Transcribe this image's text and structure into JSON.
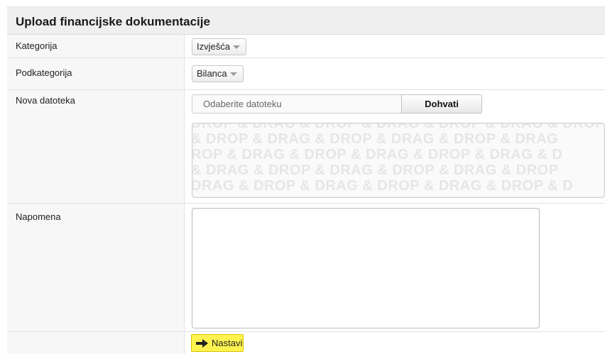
{
  "form": {
    "title": "Upload financijske dokumentacije",
    "category": {
      "label": "Kategorija",
      "selected": "Izvješća"
    },
    "subcategory": {
      "label": "Podkategorija",
      "selected": "Bilanca"
    },
    "new_file": {
      "label": "Nova datoteka",
      "placeholder": "Odaberite datoteku",
      "fetch_label": "Dohvati",
      "drop_lines": [
        "DROP & DRAG & DROP & DRAG & DROP & DRAG & DROP",
        "& DROP & DRAG & DROP & DRAG & DROP & DRAG",
        "ROP & DRAG & DROP & DRAG & DROP & DRAG & D",
        "& DRAG & DROP & DRAG & DROP & DRAG & DROP",
        "DRAG & DROP & DRAG & DROP & DRAG & DROP & D"
      ]
    },
    "note": {
      "label": "Napomena",
      "value": ""
    },
    "continue_label": "Nastavi"
  },
  "colors": {
    "header_bg": "#efefef",
    "label_bg": "#f7f7f7",
    "continue_bg": "#fff44f",
    "arrow": "#222222"
  },
  "icons": {
    "continue": "arrow-right-icon",
    "dropdown": "caret-down-icon"
  }
}
